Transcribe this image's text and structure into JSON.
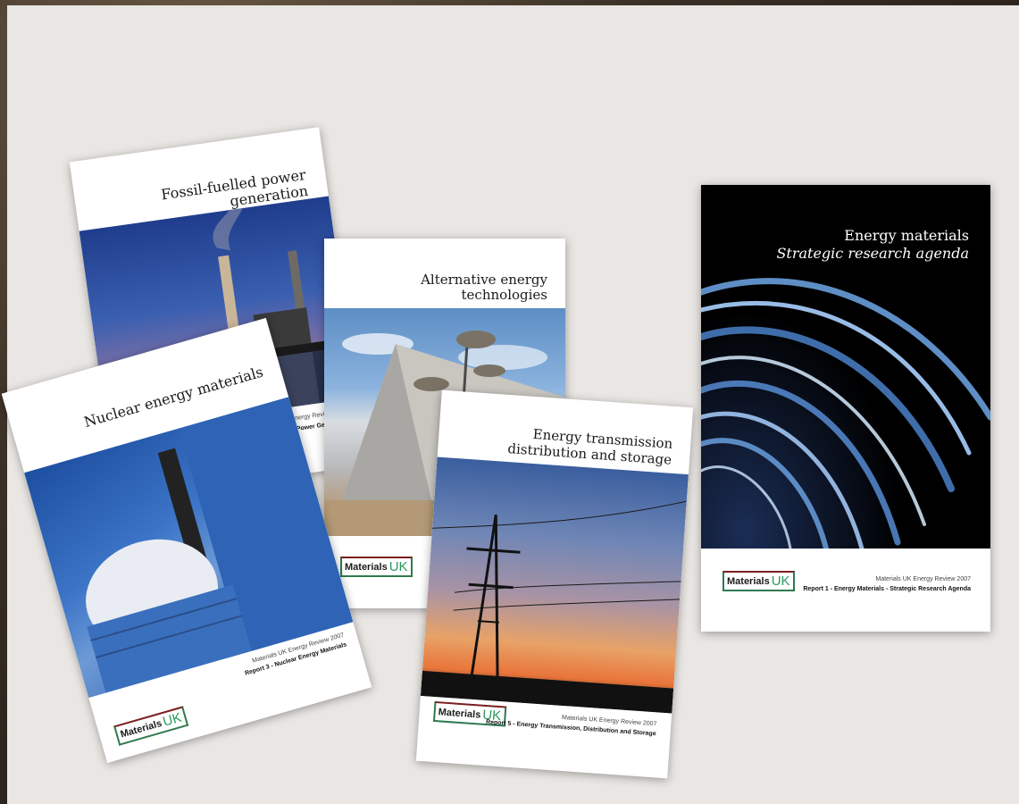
{
  "reports": [
    {
      "id": "fossil",
      "title": "Fossil-fuelled power generation",
      "footer_small": "Materials UK Energy Review 2007",
      "footer_bold": "Report 2 - Fossil-fuelled Power Generation"
    },
    {
      "id": "alternative",
      "title": "Alternative energy technologies",
      "footer_small": "",
      "footer_bold": ""
    },
    {
      "id": "nuclear",
      "title": "Nuclear energy materials",
      "footer_small": "Materials UK Energy Review 2007",
      "footer_bold": "Report 3 - Nuclear Energy Materials"
    },
    {
      "id": "transmission",
      "title_line1": "Energy transmission",
      "title_line2": "distribution and storage",
      "footer_small": "Materials UK Energy Review 2007",
      "footer_bold": "Report 5 - Energy Transmission, Distribution and Storage"
    },
    {
      "id": "energy",
      "title": "Energy materials",
      "subtitle": "Strategic research agenda",
      "footer_small": "Materials UK Energy Review 2007",
      "footer_bold": "Report 1 - Energy Materials - Strategic Research Agenda"
    }
  ],
  "logo": {
    "text1": "Materials",
    "text2": "UK"
  },
  "colors": {
    "board": "#e9e6e3",
    "logo_green": "#2a9a5a",
    "logo_red": "#7a1e1e"
  }
}
